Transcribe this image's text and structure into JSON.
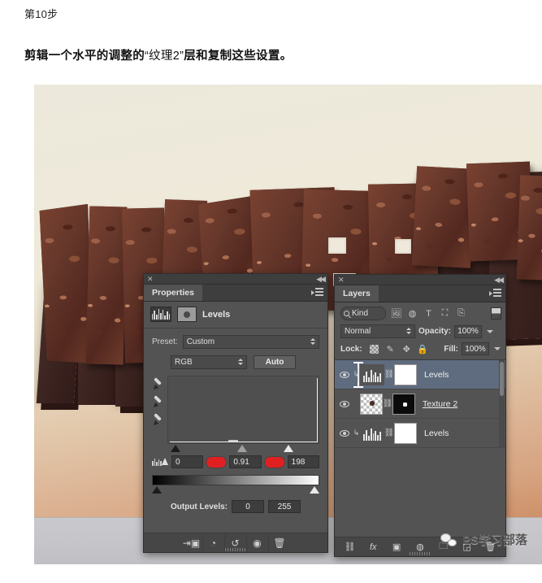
{
  "article": {
    "step_label": "第10步",
    "step_desc_1": "剪辑一个水平的调整的",
    "step_desc_quote": "“纹理2”",
    "step_desc_2": "层和复制这些设置。"
  },
  "properties_panel": {
    "tab_label": "Properties",
    "close_icon": "close-icon",
    "collapse_icon": "collapse-icon",
    "menu_icon": "panel-menu-icon",
    "adjustment_icon": "levels-histogram-icon",
    "mask_icon": "layer-mask-icon",
    "title": "Levels",
    "preset_label": "Preset:",
    "preset_value": "Custom",
    "channel_value": "RGB",
    "auto_button": "Auto",
    "eyedroppers": [
      "set-black-point-eyedropper",
      "set-gray-point-eyedropper",
      "set-white-point-eyedropper"
    ],
    "input_shadow": "0",
    "input_gamma": "0.91",
    "input_highlight": "198",
    "output_label": "Output Levels:",
    "output_black": "0",
    "output_white": "255",
    "footer_icons": [
      "clip-to-layer-icon",
      "view-previous-state-icon",
      "reset-icon",
      "toggle-visibility-icon",
      "delete-icon"
    ]
  },
  "layers_panel": {
    "tab_label": "Layers",
    "close_icon": "close-icon",
    "collapse_icon": "collapse-icon",
    "menu_icon": "panel-menu-icon",
    "filter_kind": "Kind",
    "filter_icons": [
      "filter-pixel-icon",
      "filter-adjustment-icon",
      "filter-type-icon",
      "filter-shape-icon",
      "filter-smartobject-icon"
    ],
    "blend_mode": "Normal",
    "opacity_label": "Opacity:",
    "opacity_value": "100%",
    "lock_label": "Lock:",
    "lock_icons": [
      "lock-transparent-pixels-icon",
      "lock-image-pixels-icon",
      "lock-position-icon",
      "lock-all-icon"
    ],
    "fill_label": "Fill:",
    "fill_value": "100%",
    "layers": [
      {
        "name": "Levels",
        "type": "adjustment",
        "selected": true,
        "clipped": true,
        "underline": false,
        "mask": "white"
      },
      {
        "name": "Texture 2",
        "type": "pixel",
        "selected": false,
        "clipped": false,
        "underline": true,
        "mask": "black"
      },
      {
        "name": "Levels",
        "type": "adjustment",
        "selected": false,
        "clipped": true,
        "underline": false,
        "mask": "white"
      }
    ],
    "footer_icons": [
      "link-layers-icon",
      "layer-style-fx-icon",
      "add-layer-mask-icon",
      "new-adjustment-layer-icon",
      "new-group-icon",
      "new-layer-icon",
      "delete-layer-icon"
    ]
  },
  "watermark": {
    "icon": "wechat-icon",
    "text": "PS学习部落"
  },
  "colors": {
    "panel_bg": "#535353",
    "panel_header": "#3e3e3e",
    "selected_layer": "#5f6b7e",
    "red_marker": "#e02020",
    "canvas_top": "#ece9dc",
    "canvas_bottom": "#c8845c",
    "floor": "#c5c5c9"
  }
}
